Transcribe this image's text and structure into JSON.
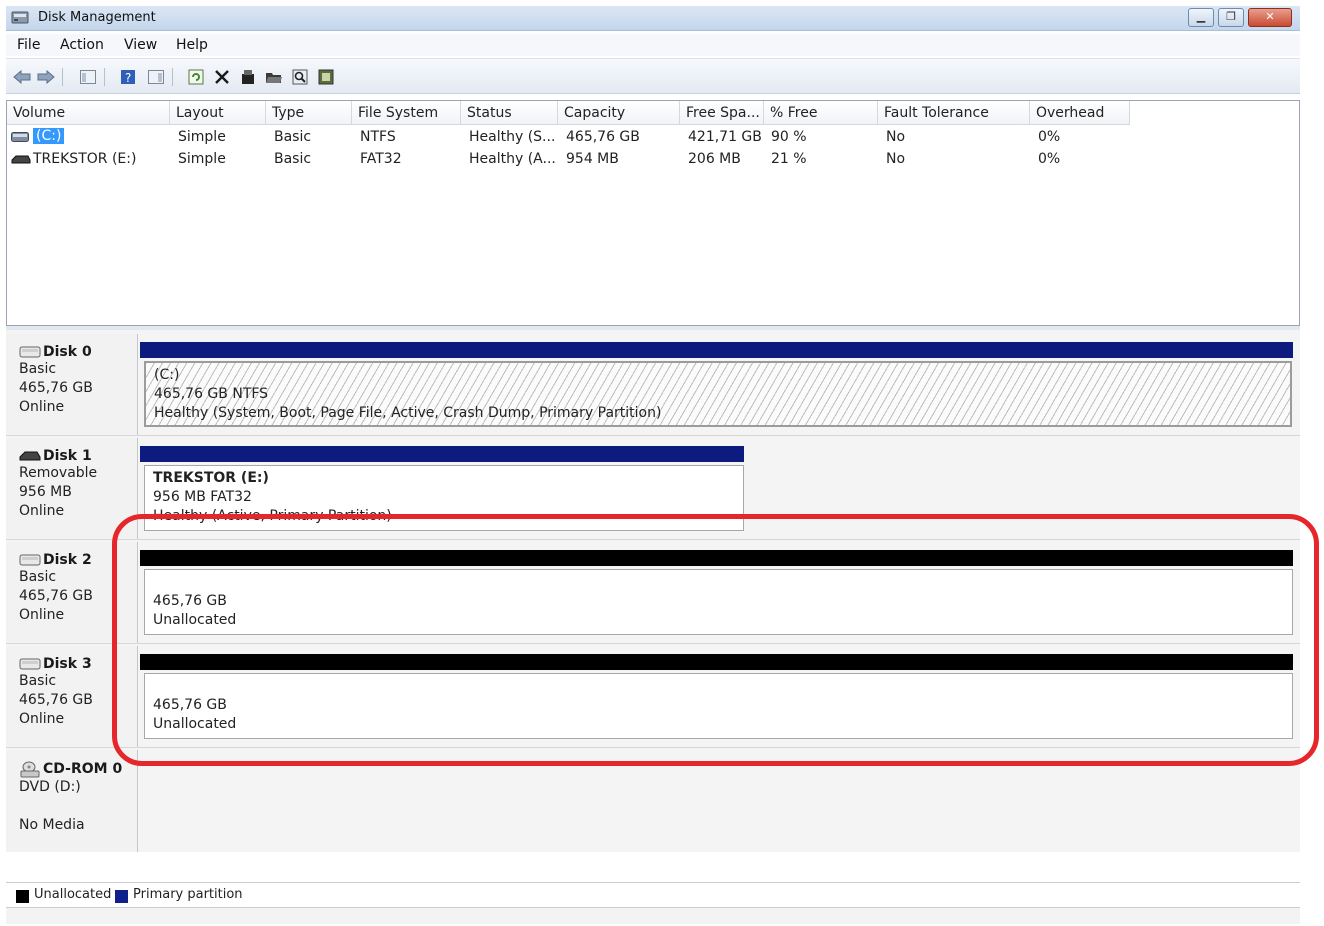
{
  "window": {
    "title": "Disk Management"
  },
  "menu": [
    "File",
    "Action",
    "View",
    "Help"
  ],
  "columns": [
    "Volume",
    "Layout",
    "Type",
    "File System",
    "Status",
    "Capacity",
    "Free Spa...",
    "% Free",
    "Fault Tolerance",
    "Overhead"
  ],
  "volumes": [
    {
      "volume": "(C:)",
      "layout": "Simple",
      "type": "Basic",
      "fs": "NTFS",
      "status": "Healthy (S...",
      "capacity": "465,76 GB",
      "free": "421,71 GB",
      "pct_free": "90 %",
      "fault": "No",
      "overhead": "0%",
      "icon": "hard-drive-icon",
      "selected": true
    },
    {
      "volume": "TREKSTOR (E:)",
      "layout": "Simple",
      "type": "Basic",
      "fs": "FAT32",
      "status": "Healthy (A...",
      "capacity": "954 MB",
      "free": "206 MB",
      "pct_free": "21 %",
      "fault": "No",
      "overhead": "0%",
      "icon": "removable-drive-icon",
      "selected": false
    }
  ],
  "disks": [
    {
      "name": "Disk 0",
      "kind": "Basic",
      "size": "465,76 GB",
      "state": "Online",
      "icon": "disk-icon",
      "partition": {
        "label": "(C:)",
        "size_fs": "465,76 GB NTFS",
        "status": "Healthy (System, Boot, Page File, Active, Crash Dump, Primary Partition)"
      }
    },
    {
      "name": "Disk 1",
      "kind": "Removable",
      "size": "956 MB",
      "state": "Online",
      "icon": "removable-disk-icon",
      "partition": {
        "label": "TREKSTOR  (E:)",
        "size_fs": "956 MB FAT32",
        "status": "Healthy (Active, Primary Partition)"
      }
    },
    {
      "name": "Disk 2",
      "kind": "Basic",
      "size": "465,76 GB",
      "state": "Online",
      "icon": "disk-icon",
      "partition": {
        "size": "465,76 GB",
        "status": "Unallocated"
      }
    },
    {
      "name": "Disk 3",
      "kind": "Basic",
      "size": "465,76 GB",
      "state": "Online",
      "icon": "disk-icon",
      "partition": {
        "size": "465,76 GB",
        "status": "Unallocated"
      }
    },
    {
      "name": "CD-ROM 0",
      "kind": "DVD (D:)",
      "state": "No Media",
      "icon": "cdrom-icon"
    }
  ],
  "legend": [
    {
      "label": "Unallocated",
      "color": "#000000"
    },
    {
      "label": "Primary partition",
      "color": "#0f1f8c"
    }
  ],
  "colors": {
    "primary_bar": "#0d1a7e",
    "unallocated_bar": "#000000",
    "selection": "#3399ff",
    "highlight": "#e5262b"
  }
}
